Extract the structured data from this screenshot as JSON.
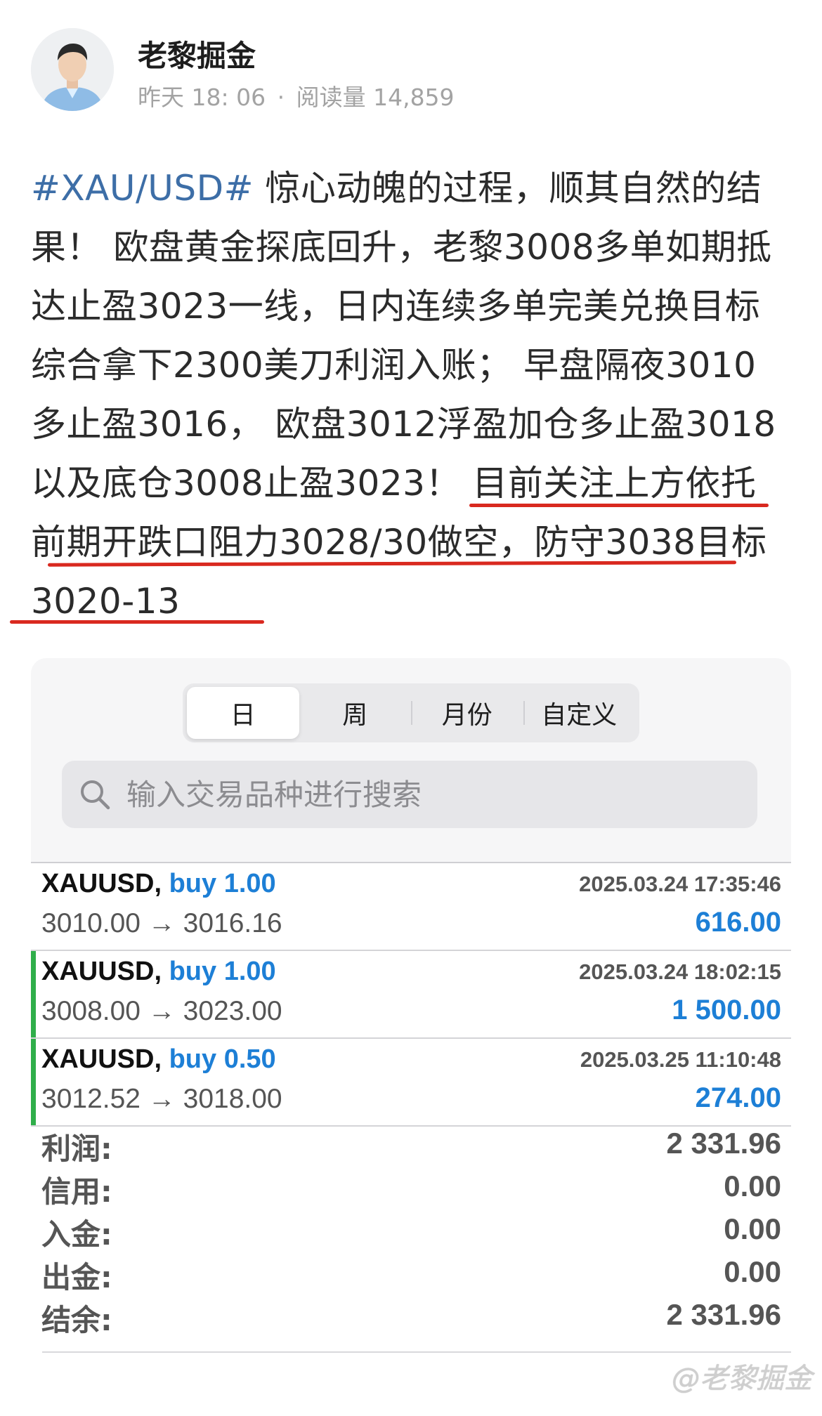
{
  "author": {
    "name": "老黎掘金",
    "time": "昨天 18: 06",
    "separator": "·",
    "reads": "阅读量 14,859"
  },
  "post": {
    "lines": [
      {
        "hashtag": "#XAU/USD#",
        "text": " 惊心动魄的过程，顺其自然的结"
      },
      {
        "text": "果！ 欧盘黄金探底回升，老黎3008多单如期抵"
      },
      {
        "text": "达止盈3023一线，日内连续多单完美兑换目标"
      },
      {
        "text": "综合拿下2300美刀利润入账； 早盘隔夜3010"
      },
      {
        "text": "多止盈3016， 欧盘3012浮盈加仓多止盈3018"
      },
      {
        "text": "以及底仓3008止盈3023！ 目前关注上方依托"
      },
      {
        "text": "前期开跌口阻力3028/30做空，防守3038目标"
      },
      {
        "text": "3020-13"
      }
    ]
  },
  "period_tabs": [
    "日",
    "周",
    "月份",
    "自定义"
  ],
  "active_tab": "日",
  "search": {
    "placeholder": "输入交易品种进行搜索"
  },
  "deals": [
    {
      "symbol": "XAUUSD,",
      "side": "buy 1.00",
      "time": "2025.03.24 17:35:46",
      "prices": "3010.00 → 3016.16",
      "profit": "616.00",
      "highlight": false
    },
    {
      "symbol": "XAUUSD,",
      "side": "buy 1.00",
      "time": "2025.03.24 18:02:15",
      "prices": "3008.00 → 3023.00",
      "profit": "1 500.00",
      "highlight": true
    },
    {
      "symbol": "XAUUSD,",
      "side": "buy 0.50",
      "time": "2025.03.25 11:10:48",
      "prices": "3012.52 → 3018.00",
      "profit": "274.00",
      "highlight": true
    }
  ],
  "summary": [
    {
      "label": "利润:",
      "value": "2 331.96"
    },
    {
      "label": "信用:",
      "value": "0.00"
    },
    {
      "label": "入金:",
      "value": "0.00"
    },
    {
      "label": "出金:",
      "value": "0.00"
    },
    {
      "label": "结余:",
      "value": "2 331.96"
    }
  ],
  "watermark": "@老黎掘金",
  "colors": {
    "hashtag": "#3d6ea7",
    "underline": "#d9291f",
    "buy": "#1d7fd6",
    "highlight_bar": "#2fae4a"
  }
}
